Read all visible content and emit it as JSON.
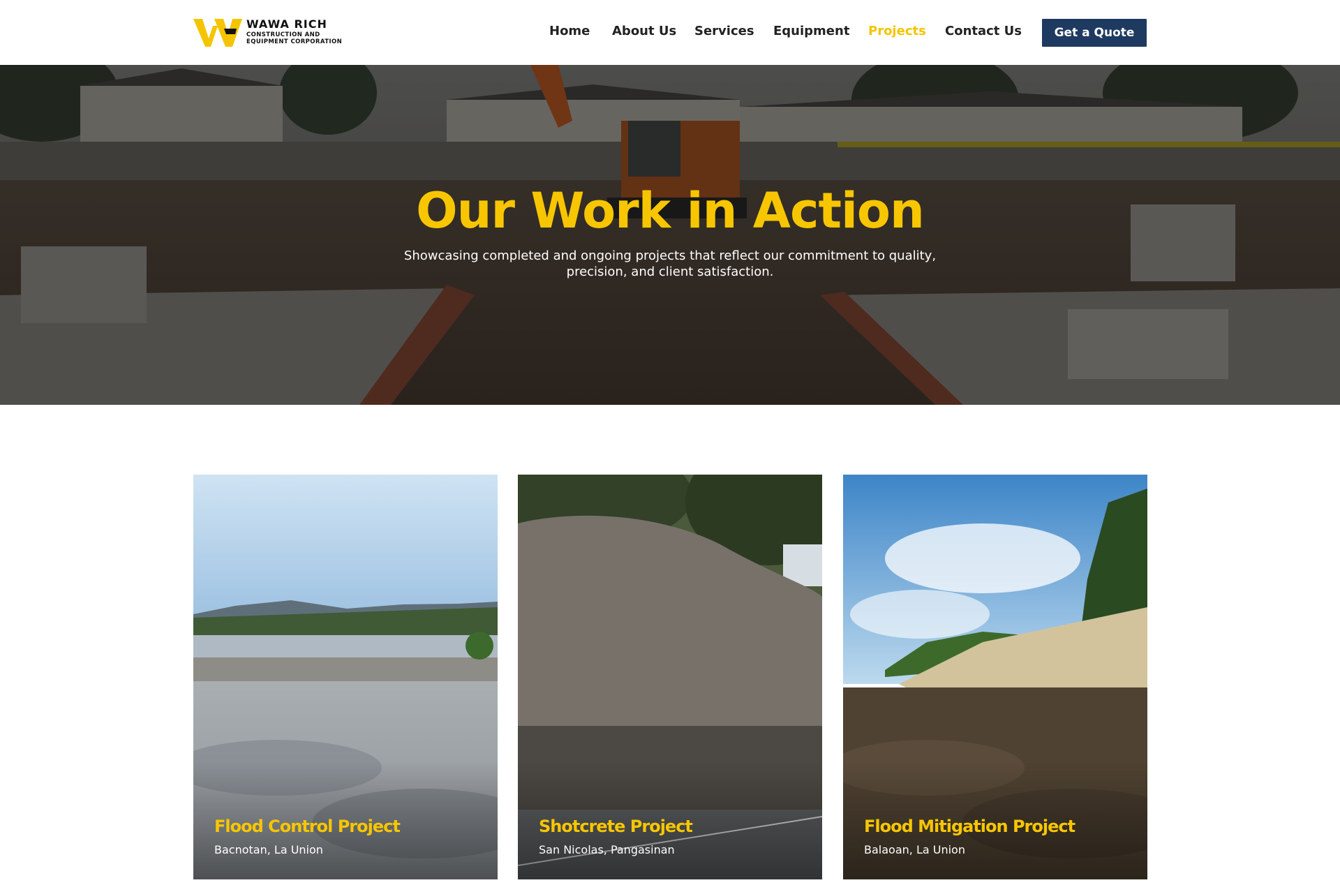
{
  "brand": {
    "name": "WAWA RICH",
    "tagline": "CONSTRUCTION AND EQUIPMENT CORPORATION",
    "accent": "#f5c400",
    "navy": "#1f3a60"
  },
  "nav": {
    "items": [
      {
        "label": "Home",
        "active": false
      },
      {
        "label": "About Us",
        "active": false
      },
      {
        "label": "Services",
        "active": false
      },
      {
        "label": "Equipment",
        "active": false
      },
      {
        "label": "Projects",
        "active": true
      },
      {
        "label": "Contact Us",
        "active": false
      }
    ],
    "cta": "Get a Quote"
  },
  "hero": {
    "title": "Our Work in Action",
    "subtitle": "Showcasing completed and ongoing projects that reflect our commitment to quality, precision, and client satisfaction."
  },
  "projects": [
    {
      "title": "Flood Control Project",
      "location": "Bacnotan, La Union"
    },
    {
      "title": "Shotcrete Project",
      "location": "San Nicolas, Pangasinan"
    },
    {
      "title": "Flood Mitigation Project",
      "location": "Balaoan, La Union"
    }
  ]
}
